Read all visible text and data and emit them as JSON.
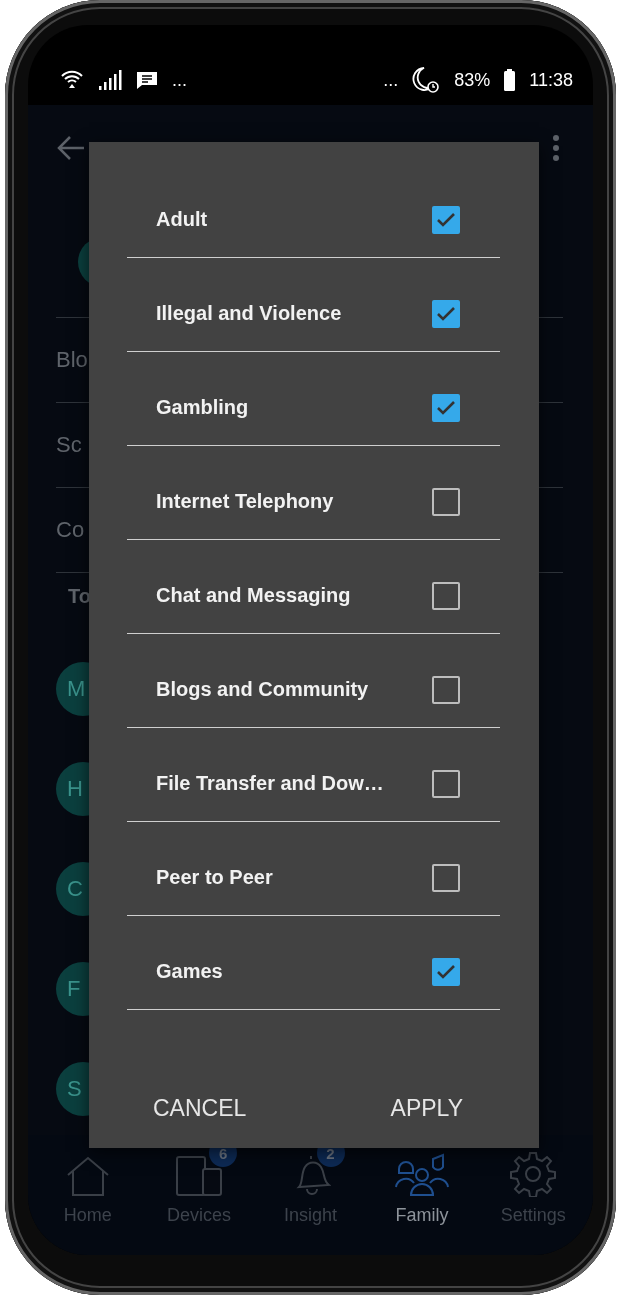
{
  "status_bar": {
    "left_more": "...",
    "right_more": "...",
    "battery": "83%",
    "time": "11:38"
  },
  "background": {
    "rows": [
      {
        "label": "Blo"
      },
      {
        "label": "Sc"
      },
      {
        "label": "Co"
      }
    ],
    "section_label": "To",
    "avatars": [
      {
        "initial": "M"
      },
      {
        "initial": "H"
      },
      {
        "initial": "C"
      },
      {
        "initial": "F"
      },
      {
        "initial": "S"
      }
    ]
  },
  "nav": [
    {
      "label": "Home",
      "selected": false
    },
    {
      "label": "Devices",
      "badge": "6",
      "selected": false
    },
    {
      "label": "Insight",
      "badge": "2",
      "selected": false
    },
    {
      "label": "Family",
      "selected": true
    },
    {
      "label": "Settings",
      "selected": false
    }
  ],
  "dialog": {
    "options": [
      {
        "label": "Adult",
        "checked": true
      },
      {
        "label": "Illegal and Violence",
        "checked": true
      },
      {
        "label": "Gambling",
        "checked": true
      },
      {
        "label": "Internet Telephony",
        "checked": false
      },
      {
        "label": "Chat and Messaging",
        "checked": false
      },
      {
        "label": "Blogs and Community",
        "checked": false
      },
      {
        "label": "File Transfer and Dow…",
        "checked": false
      },
      {
        "label": "Peer to Peer",
        "checked": false
      },
      {
        "label": "Games",
        "checked": true
      }
    ],
    "buttons": [
      {
        "label": "CANCEL"
      },
      {
        "label": "APPLY"
      }
    ]
  }
}
